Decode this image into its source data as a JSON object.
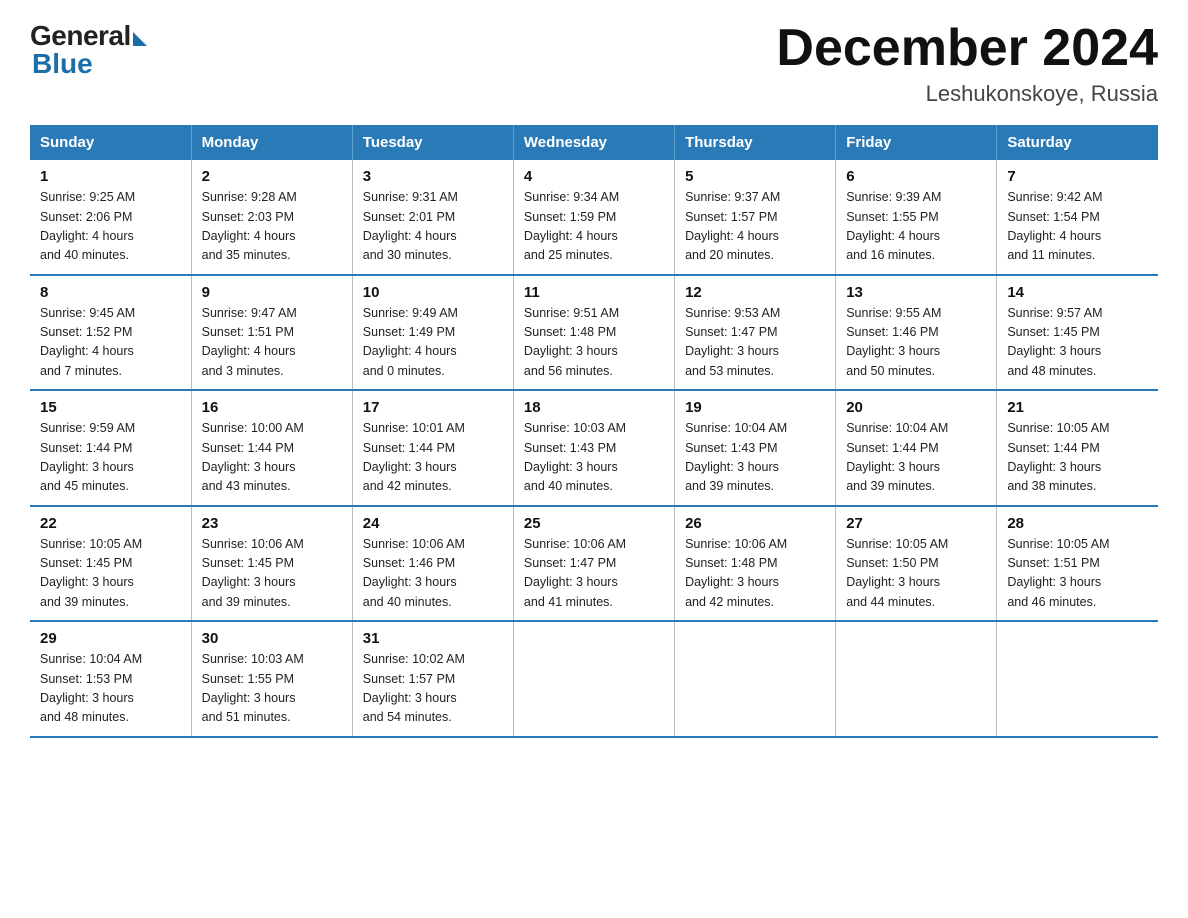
{
  "logo": {
    "general": "General",
    "blue": "Blue"
  },
  "title": "December 2024",
  "location": "Leshukonskoye, Russia",
  "headers": [
    "Sunday",
    "Monday",
    "Tuesday",
    "Wednesday",
    "Thursday",
    "Friday",
    "Saturday"
  ],
  "weeks": [
    [
      {
        "day": "1",
        "info": "Sunrise: 9:25 AM\nSunset: 2:06 PM\nDaylight: 4 hours\nand 40 minutes."
      },
      {
        "day": "2",
        "info": "Sunrise: 9:28 AM\nSunset: 2:03 PM\nDaylight: 4 hours\nand 35 minutes."
      },
      {
        "day": "3",
        "info": "Sunrise: 9:31 AM\nSunset: 2:01 PM\nDaylight: 4 hours\nand 30 minutes."
      },
      {
        "day": "4",
        "info": "Sunrise: 9:34 AM\nSunset: 1:59 PM\nDaylight: 4 hours\nand 25 minutes."
      },
      {
        "day": "5",
        "info": "Sunrise: 9:37 AM\nSunset: 1:57 PM\nDaylight: 4 hours\nand 20 minutes."
      },
      {
        "day": "6",
        "info": "Sunrise: 9:39 AM\nSunset: 1:55 PM\nDaylight: 4 hours\nand 16 minutes."
      },
      {
        "day": "7",
        "info": "Sunrise: 9:42 AM\nSunset: 1:54 PM\nDaylight: 4 hours\nand 11 minutes."
      }
    ],
    [
      {
        "day": "8",
        "info": "Sunrise: 9:45 AM\nSunset: 1:52 PM\nDaylight: 4 hours\nand 7 minutes."
      },
      {
        "day": "9",
        "info": "Sunrise: 9:47 AM\nSunset: 1:51 PM\nDaylight: 4 hours\nand 3 minutes."
      },
      {
        "day": "10",
        "info": "Sunrise: 9:49 AM\nSunset: 1:49 PM\nDaylight: 4 hours\nand 0 minutes."
      },
      {
        "day": "11",
        "info": "Sunrise: 9:51 AM\nSunset: 1:48 PM\nDaylight: 3 hours\nand 56 minutes."
      },
      {
        "day": "12",
        "info": "Sunrise: 9:53 AM\nSunset: 1:47 PM\nDaylight: 3 hours\nand 53 minutes."
      },
      {
        "day": "13",
        "info": "Sunrise: 9:55 AM\nSunset: 1:46 PM\nDaylight: 3 hours\nand 50 minutes."
      },
      {
        "day": "14",
        "info": "Sunrise: 9:57 AM\nSunset: 1:45 PM\nDaylight: 3 hours\nand 48 minutes."
      }
    ],
    [
      {
        "day": "15",
        "info": "Sunrise: 9:59 AM\nSunset: 1:44 PM\nDaylight: 3 hours\nand 45 minutes."
      },
      {
        "day": "16",
        "info": "Sunrise: 10:00 AM\nSunset: 1:44 PM\nDaylight: 3 hours\nand 43 minutes."
      },
      {
        "day": "17",
        "info": "Sunrise: 10:01 AM\nSunset: 1:44 PM\nDaylight: 3 hours\nand 42 minutes."
      },
      {
        "day": "18",
        "info": "Sunrise: 10:03 AM\nSunset: 1:43 PM\nDaylight: 3 hours\nand 40 minutes."
      },
      {
        "day": "19",
        "info": "Sunrise: 10:04 AM\nSunset: 1:43 PM\nDaylight: 3 hours\nand 39 minutes."
      },
      {
        "day": "20",
        "info": "Sunrise: 10:04 AM\nSunset: 1:44 PM\nDaylight: 3 hours\nand 39 minutes."
      },
      {
        "day": "21",
        "info": "Sunrise: 10:05 AM\nSunset: 1:44 PM\nDaylight: 3 hours\nand 38 minutes."
      }
    ],
    [
      {
        "day": "22",
        "info": "Sunrise: 10:05 AM\nSunset: 1:45 PM\nDaylight: 3 hours\nand 39 minutes."
      },
      {
        "day": "23",
        "info": "Sunrise: 10:06 AM\nSunset: 1:45 PM\nDaylight: 3 hours\nand 39 minutes."
      },
      {
        "day": "24",
        "info": "Sunrise: 10:06 AM\nSunset: 1:46 PM\nDaylight: 3 hours\nand 40 minutes."
      },
      {
        "day": "25",
        "info": "Sunrise: 10:06 AM\nSunset: 1:47 PM\nDaylight: 3 hours\nand 41 minutes."
      },
      {
        "day": "26",
        "info": "Sunrise: 10:06 AM\nSunset: 1:48 PM\nDaylight: 3 hours\nand 42 minutes."
      },
      {
        "day": "27",
        "info": "Sunrise: 10:05 AM\nSunset: 1:50 PM\nDaylight: 3 hours\nand 44 minutes."
      },
      {
        "day": "28",
        "info": "Sunrise: 10:05 AM\nSunset: 1:51 PM\nDaylight: 3 hours\nand 46 minutes."
      }
    ],
    [
      {
        "day": "29",
        "info": "Sunrise: 10:04 AM\nSunset: 1:53 PM\nDaylight: 3 hours\nand 48 minutes."
      },
      {
        "day": "30",
        "info": "Sunrise: 10:03 AM\nSunset: 1:55 PM\nDaylight: 3 hours\nand 51 minutes."
      },
      {
        "day": "31",
        "info": "Sunrise: 10:02 AM\nSunset: 1:57 PM\nDaylight: 3 hours\nand 54 minutes."
      },
      null,
      null,
      null,
      null
    ]
  ]
}
